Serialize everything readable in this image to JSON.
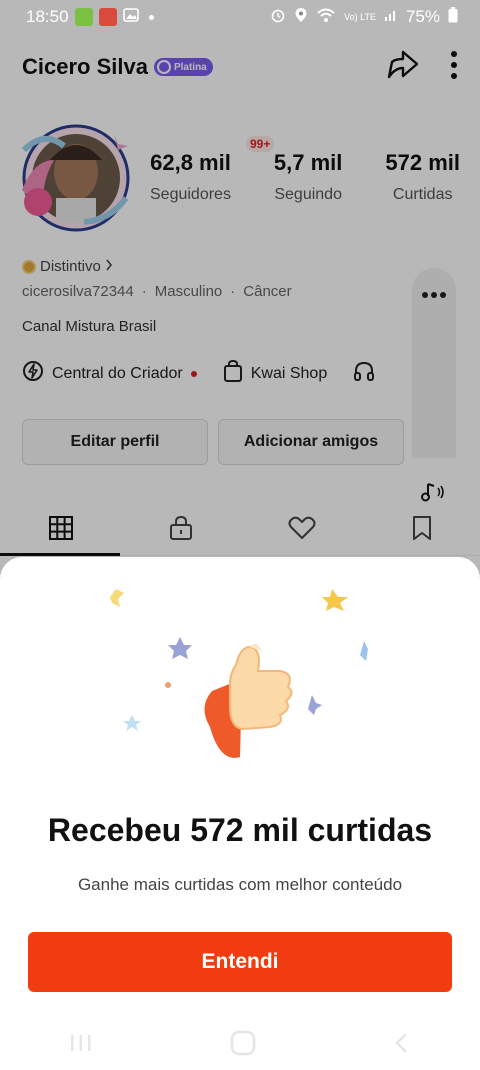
{
  "status_bar": {
    "time": "18:50",
    "battery": "75%",
    "network": "Vo) LTE"
  },
  "profile": {
    "name": "Cicero Silva",
    "badge": "Platina",
    "notification_count": "99+",
    "stats": [
      {
        "value": "62,8 mil",
        "label": "Seguidores"
      },
      {
        "value": "5,7 mil",
        "label": "Seguindo"
      },
      {
        "value": "572 mil",
        "label": "Curtidas"
      }
    ],
    "distintivo": "Distintivo",
    "handle": "cicerosilva72344",
    "gender": "Masculino",
    "sign": "Câncer",
    "separator": "·",
    "bio": "Canal Mistura Brasil",
    "links": {
      "creator": "Central do Criador",
      "shop": "Kwai Shop"
    },
    "buttons": {
      "edit": "Editar perfil",
      "add_friends": "Adicionar amigos"
    }
  },
  "sheet": {
    "title": "Recebeu 572 mil curtidas",
    "subtitle": "Ganhe mais curtidas com melhor conteúdo",
    "cta": "Entendi"
  },
  "colors": {
    "accent": "#f03c10",
    "badge": "#7b5cf0",
    "notification": "#e02020"
  }
}
